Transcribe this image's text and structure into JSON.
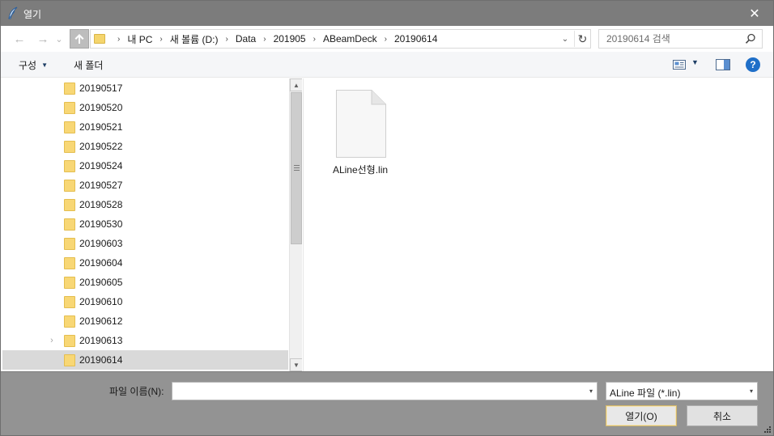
{
  "window": {
    "title": "열기",
    "close_glyph": "✕",
    "colors": {
      "titlebar": "#7c7c7c",
      "bottom_panel": "#939393",
      "folder": "#f8d775",
      "help": "#1f6fc8"
    }
  },
  "nav": {
    "back_glyph": "←",
    "forward_glyph": "→",
    "recent_glyph": "⌄",
    "up_icon": "up-arrow-icon"
  },
  "address": {
    "crumbs": [
      "내 PC",
      "새 볼륨 (D:)",
      "Data",
      "201905",
      "ABeamDeck",
      "20190614"
    ],
    "sep_glyph": "›",
    "dropdown_glyph": "⌄",
    "refresh_glyph": "↻"
  },
  "search": {
    "placeholder": "20190614 검색"
  },
  "toolbar": {
    "organize_label": "구성",
    "new_folder_label": "새 폴더",
    "caret": "▼",
    "help_glyph": "?"
  },
  "tree": {
    "expander_glyph": "›",
    "items": [
      {
        "label": "20190517",
        "selected": false,
        "expandable": false
      },
      {
        "label": "20190520",
        "selected": false,
        "expandable": false
      },
      {
        "label": "20190521",
        "selected": false,
        "expandable": false
      },
      {
        "label": "20190522",
        "selected": false,
        "expandable": false
      },
      {
        "label": "20190524",
        "selected": false,
        "expandable": false
      },
      {
        "label": "20190527",
        "selected": false,
        "expandable": false
      },
      {
        "label": "20190528",
        "selected": false,
        "expandable": false
      },
      {
        "label": "20190530",
        "selected": false,
        "expandable": false
      },
      {
        "label": "20190603",
        "selected": false,
        "expandable": false
      },
      {
        "label": "20190604",
        "selected": false,
        "expandable": false
      },
      {
        "label": "20190605",
        "selected": false,
        "expandable": false
      },
      {
        "label": "20190610",
        "selected": false,
        "expandable": false
      },
      {
        "label": "20190612",
        "selected": false,
        "expandable": false
      },
      {
        "label": "20190613",
        "selected": false,
        "expandable": true
      },
      {
        "label": "20190614",
        "selected": true,
        "expandable": false
      }
    ],
    "scroll_up_glyph": "▲",
    "scroll_down_glyph": "▼"
  },
  "files": [
    {
      "name": "ALine선형.lin",
      "icon": "document-icon"
    }
  ],
  "bottom": {
    "filename_label": "파일 이름(N):",
    "filename_value": "",
    "filter_value": "ALine 파일 (*.lin)",
    "dd_glyph": "▾",
    "open_label": "열기(O)",
    "cancel_label": "취소"
  }
}
